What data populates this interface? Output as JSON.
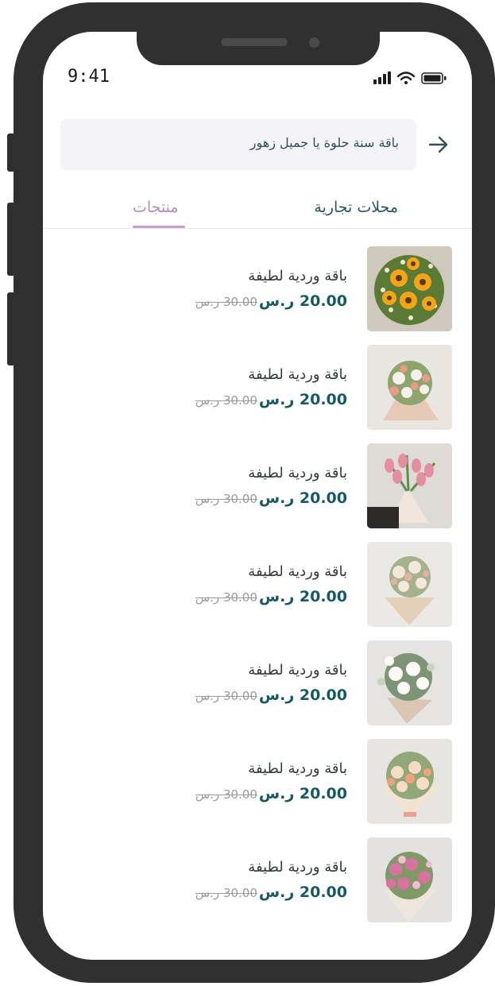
{
  "status_bar": {
    "time": "9:41"
  },
  "search": {
    "query": "باقة سنة حلوة يا جميل زهور",
    "back_icon": "arrow-right-icon"
  },
  "tabs": [
    {
      "label": "محلات تجارية",
      "active": false
    },
    {
      "label": "منتجات",
      "active": true
    }
  ],
  "colors": {
    "accent": "#c79ed2",
    "price": "#185a62",
    "frame": "#303030"
  },
  "products": [
    {
      "name": "باقة وردية لطيفة",
      "price": "20.00 ر.س",
      "old_price": "30.00 ر.س",
      "image": "sunflower-bouquet"
    },
    {
      "name": "باقة وردية لطيفة",
      "price": "20.00 ر.س",
      "old_price": "30.00 ر.س",
      "image": "peach-rose-bouquet"
    },
    {
      "name": "باقة وردية لطيفة",
      "price": "20.00 ر.س",
      "old_price": "30.00 ر.س",
      "image": "pink-tulip-bouquet"
    },
    {
      "name": "باقة وردية لطيفة",
      "price": "20.00 ر.س",
      "old_price": "30.00 ر.س",
      "image": "cream-bouquet"
    },
    {
      "name": "باقة وردية لطيفة",
      "price": "20.00 ر.س",
      "old_price": "30.00 ر.س",
      "image": "white-bouquet"
    },
    {
      "name": "باقة وردية لطيفة",
      "price": "20.00 ر.س",
      "old_price": "30.00 ر.س",
      "image": "peach-garden-bouquet"
    },
    {
      "name": "باقة وردية لطيفة",
      "price": "20.00 ر.س",
      "old_price": "30.00 ر.س",
      "image": "pink-lisianthus-bouquet"
    }
  ]
}
